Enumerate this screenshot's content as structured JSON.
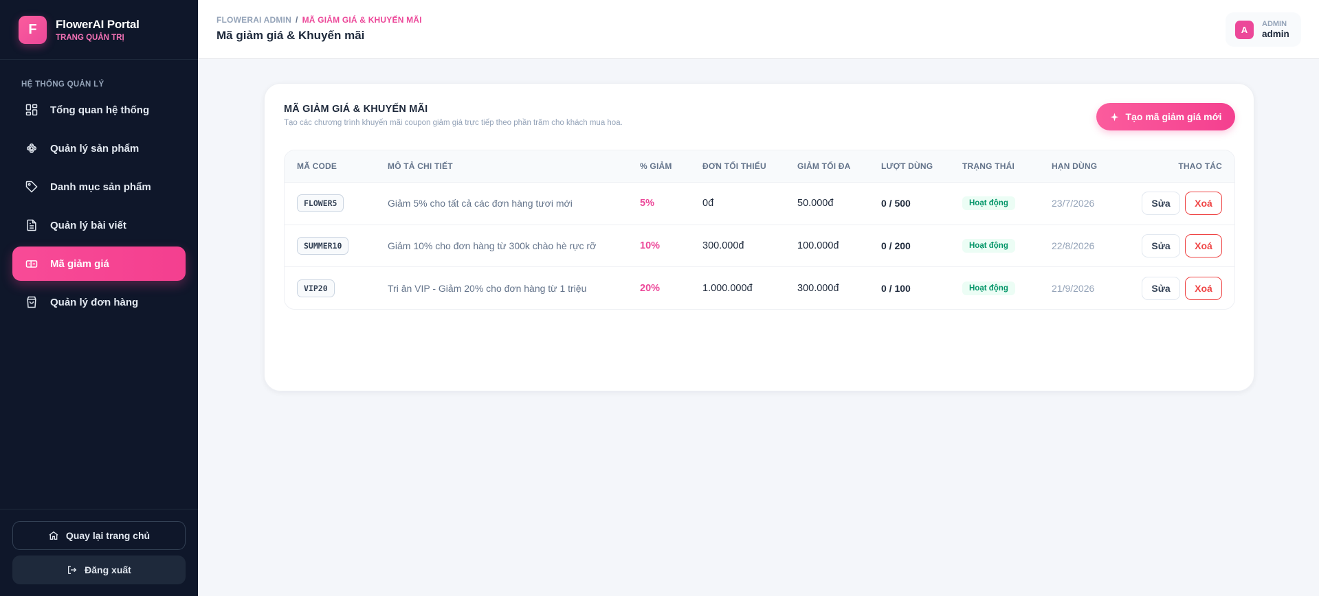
{
  "brand": {
    "logo_letter": "F",
    "name": "FlowerAI Portal",
    "subtitle": "TRANG QUẢN TRỊ"
  },
  "sidebar": {
    "section_label": "HỆ THỐNG QUẢN LÝ",
    "items": [
      {
        "label": "Tổng quan hệ thống",
        "icon": "grid-icon",
        "active": false
      },
      {
        "label": "Quản lý sản phẩm",
        "icon": "flower-icon",
        "active": false
      },
      {
        "label": "Danh mục sản phẩm",
        "icon": "tag-icon",
        "active": false
      },
      {
        "label": "Quản lý bài viết",
        "icon": "document-icon",
        "active": false
      },
      {
        "label": "Mã giảm giá",
        "icon": "ticket-icon",
        "active": true
      },
      {
        "label": "Quản lý đơn hàng",
        "icon": "shopping-bag-icon",
        "active": false
      }
    ],
    "back_home_label": "Quay lại trang chủ",
    "logout_label": "Đăng xuất"
  },
  "header": {
    "breadcrumb_root": "FLOWERAI ADMIN",
    "breadcrumb_sep": "/",
    "breadcrumb_current": "MÃ GIẢM GIÁ & KHUYẾN MÃI",
    "title": "Mã giảm giá & Khuyến mãi",
    "user": {
      "avatar_letter": "A",
      "role": "ADMIN",
      "name": "admin"
    }
  },
  "card": {
    "title": "MÃ GIẢM GIÁ & KHUYẾN MÃI",
    "subtitle": "Tạo các chương trình khuyến mãi coupon giảm giá trực tiếp theo phần trăm cho khách mua hoa.",
    "create_button": "Tạo mã giảm giá mới"
  },
  "table": {
    "headers": {
      "code": "MÃ CODE",
      "desc": "MÔ TẢ CHI TIẾT",
      "pct": "% GIẢM",
      "min": "ĐƠN TỐI THIỂU",
      "max": "GIẢM TỐI ĐA",
      "usage": "LƯỢT DÙNG",
      "status": "TRẠNG THÁI",
      "expiry": "HẠN DÙNG",
      "actions": "THAO TÁC"
    },
    "rows": [
      {
        "code": "FLOWER5",
        "desc": "Giảm 5% cho tất cả các đơn hàng tươi mới",
        "pct": "5%",
        "min": "0đ",
        "max": "50.000đ",
        "usage": "0 / 500",
        "status": "Hoạt động",
        "expiry": "23/7/2026",
        "edit": "Sửa",
        "delete": "Xoá"
      },
      {
        "code": "SUMMER10",
        "desc": "Giảm 10% cho đơn hàng từ 300k chào hè rực rỡ",
        "pct": "10%",
        "min": "300.000đ",
        "max": "100.000đ",
        "usage": "0 / 200",
        "status": "Hoạt động",
        "expiry": "22/8/2026",
        "edit": "Sửa",
        "delete": "Xoá"
      },
      {
        "code": "VIP20",
        "desc": "Tri ân VIP - Giảm 20% cho đơn hàng từ 1 triệu",
        "pct": "20%",
        "min": "1.000.000đ",
        "max": "300.000đ",
        "usage": "0 / 100",
        "status": "Hoạt động",
        "expiry": "21/9/2026",
        "edit": "Sửa",
        "delete": "Xoá"
      }
    ]
  },
  "colors": {
    "accent": "#f43f8f",
    "sidebar_bg": "#0f172a",
    "active_status": "#059669",
    "danger": "#ef4444"
  }
}
